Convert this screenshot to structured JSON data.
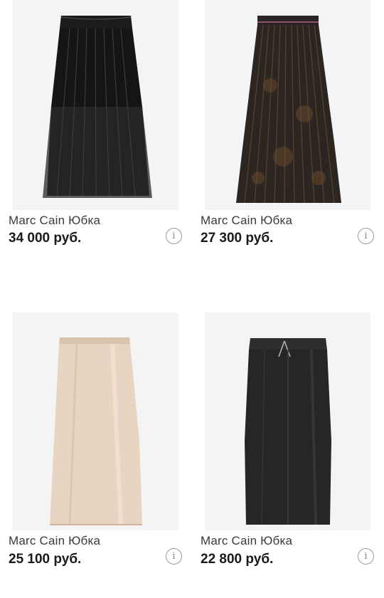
{
  "products": [
    {
      "brand_title": "Marc Cain Юбка",
      "price": "34 000 руб.",
      "image_icon": "black-pleated-tulle-skirt"
    },
    {
      "brand_title": "Marc Cain Юбка",
      "price": "27 300 руб.",
      "image_icon": "dark-printed-pleated-skirt"
    },
    {
      "brand_title": "Marc Cain Юбка",
      "price": "25 100 руб.",
      "image_icon": "beige-satin-midi-skirt"
    },
    {
      "brand_title": "Marc Cain Юбка",
      "price": "22 800 руб.",
      "image_icon": "black-leather-pencil-skirt"
    }
  ],
  "info_icon_glyph": "i"
}
